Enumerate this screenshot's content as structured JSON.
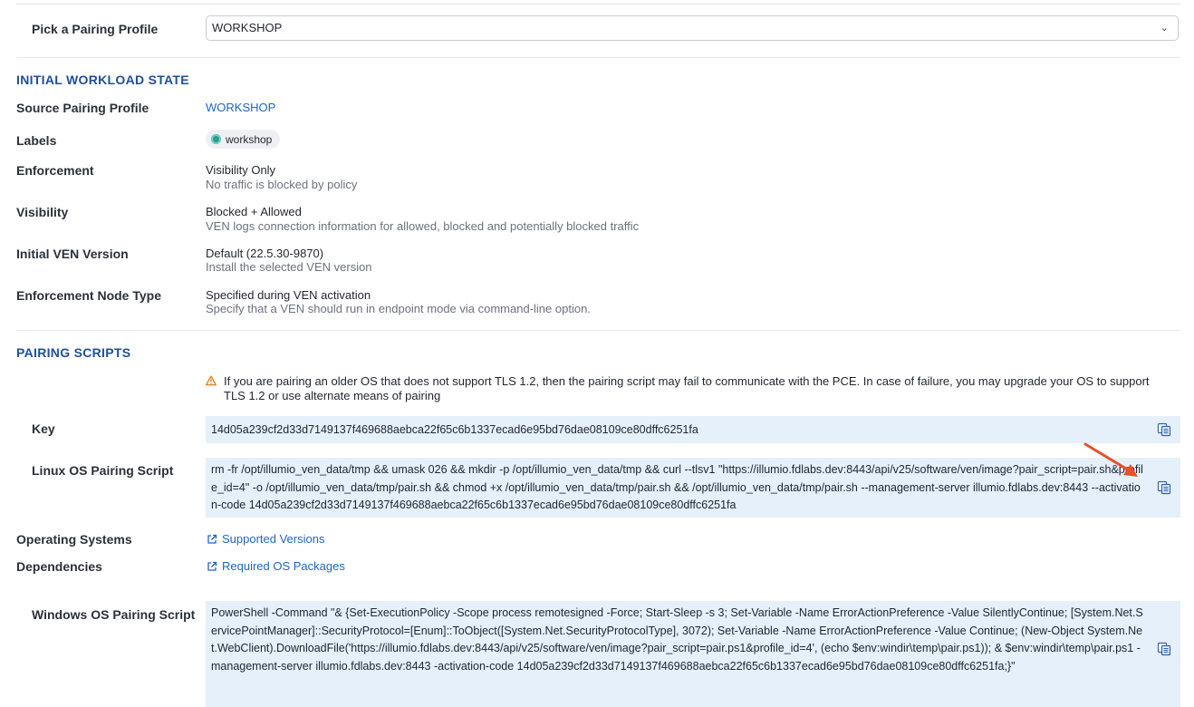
{
  "pairing_profile": {
    "label": "Pick a Pairing Profile",
    "selected": "WORKSHOP"
  },
  "initial_state": {
    "title": "INITIAL WORKLOAD STATE",
    "source_label": "Source Pairing Profile",
    "source_value": "WORKSHOP",
    "labels_label": "Labels",
    "labels_chip": "workshop",
    "enforcement_label": "Enforcement",
    "enforcement_value": "Visibility Only",
    "enforcement_sub": "No traffic is blocked by policy",
    "visibility_label": "Visibility",
    "visibility_value": "Blocked + Allowed",
    "visibility_sub": "VEN logs connection information for allowed, blocked and potentially blocked traffic",
    "ven_version_label": "Initial VEN Version",
    "ven_version_value": "Default (22.5.30-9870)",
    "ven_version_sub": "Install the selected VEN version",
    "node_type_label": "Enforcement Node Type",
    "node_type_value": "Specified during VEN activation",
    "node_type_sub": "Specify that a VEN should run in endpoint mode via command-line option."
  },
  "pairing_scripts": {
    "title": "PAIRING SCRIPTS",
    "warning_line1": "If you are pairing an older OS that does not support TLS 1.2, then the pairing script may fail to communicate with the PCE. In case of failure, you may upgrade your OS to support",
    "warning_line2": "TLS 1.2 or use alternate means of pairing",
    "key_label": "Key",
    "key_value": "14d05a239cf2d33d7149137f469688aebca22f65c6b1337ecad6e95bd76dae08109ce80dffc6251fa",
    "linux_label": "Linux OS Pairing Script",
    "linux_script": "rm -fr /opt/illumio_ven_data/tmp && umask 026 && mkdir -p /opt/illumio_ven_data/tmp && curl --tlsv1 \"https://illumio.fdlabs.dev:8443/api/v25/software/ven/image?pair_script=pair.sh&profile_id=4\" -o /opt/illumio_ven_data/tmp/pair.sh && chmod +x /opt/illumio_ven_data/tmp/pair.sh && /opt/illumio_ven_data/tmp/pair.sh --management-server illumio.fdlabs.dev:8443 --activation-code 14d05a239cf2d33d7149137f469688aebca22f65c6b1337ecad6e95bd76dae08109ce80dffc6251fa",
    "os_label": "Operating Systems",
    "os_link": "Supported Versions",
    "deps_label": "Dependencies",
    "deps_link": "Required OS Packages",
    "windows_label": "Windows OS Pairing Script",
    "windows_script": "PowerShell -Command \"& {Set-ExecutionPolicy -Scope process remotesigned -Force; Start-Sleep -s 3; Set-Variable -Name ErrorActionPreference -Value SilentlyContinue; [System.Net.ServicePointManager]::SecurityProtocol=[Enum]::ToObject([System.Net.SecurityProtocolType], 3072); Set-Variable -Name ErrorActionPreference -Value Continue; (New-Object System.Net.WebClient).DownloadFile('https://illumio.fdlabs.dev:8443/api/v25/software/ven/image?pair_script=pair.ps1&profile_id=4', (echo $env:windir\\temp\\pair.ps1)); & $env:windir\\temp\\pair.ps1 -management-server illumio.fdlabs.dev:8443 -activation-code 14d05a239cf2d33d7149137f469688aebca22f65c6b1337ecad6e95bd76dae08109ce80dffc6251fa;}\""
  },
  "icons": {
    "copy": "copy-icon",
    "external": "external-link-icon",
    "warning": "warning-icon",
    "label_chip": "environment-label-icon"
  },
  "colors": {
    "section_title": "#1f4f9a",
    "link": "#1e66c7",
    "code_bg": "#e6f0fa",
    "arrow": "#e8502a"
  }
}
